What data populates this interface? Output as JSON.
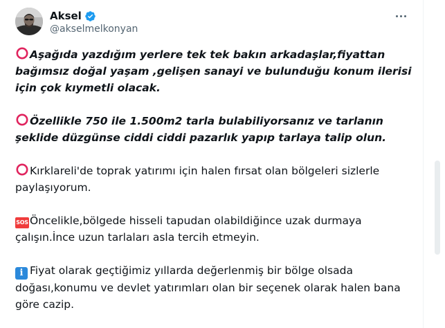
{
  "author": {
    "display_name": "Aksel",
    "handle": "@akselmelkonyan",
    "verified": true,
    "avatar_icon": "profile-photo"
  },
  "menu": {
    "more_icon": "more-horizontal-icon"
  },
  "icons": {
    "circle": "hollow-red-circle-emoji",
    "sos": "SOS",
    "info": "i"
  },
  "tweet": {
    "paragraphs": [
      {
        "icon": "circle",
        "bold_italic": true,
        "text": "Aşağıda yazdığım yerlere tek tek bakın arkadaşlar,fiyattan bağımsız doğal yaşam ,gelişen sanayi ve bulunduğu konum ilerisi için çok kıymetli olacak."
      },
      {
        "icon": "circle",
        "bold_italic": true,
        "text": "Özellikle 750 ile 1.500m2 tarla bulabiliyorsanız ve tarlanın şeklide düzgünse ciddi ciddi pazarlık yapıp tarlaya talip olun."
      },
      {
        "icon": "circle",
        "bold_italic": false,
        "text": "Kırklareli'de toprak yatırımı için halen fırsat olan bölgeleri sizlerle paylaşıyorum."
      },
      {
        "icon": "sos",
        "bold_italic": false,
        "text": "Öncelikle,bölgede hisseli tapudan olabildiğince uzak durmaya çalışın.İnce uzun tarlaları asla tercih etmeyin."
      },
      {
        "icon": "info",
        "bold_italic": false,
        "text": "Fiyat olarak geçtiğimiz yıllarda değerlenmiş bir bölge olsada doğası,konumu ve devlet yatırımları olan bir seçenek olarak halen bana göre cazip."
      }
    ]
  },
  "colors": {
    "text": "#0f1419",
    "secondary_text": "#536471",
    "verified_blue": "#1d9bf0",
    "circle_red": "#e0245e",
    "sos_red": "#f03c3c",
    "info_blue": "#2b89db"
  }
}
